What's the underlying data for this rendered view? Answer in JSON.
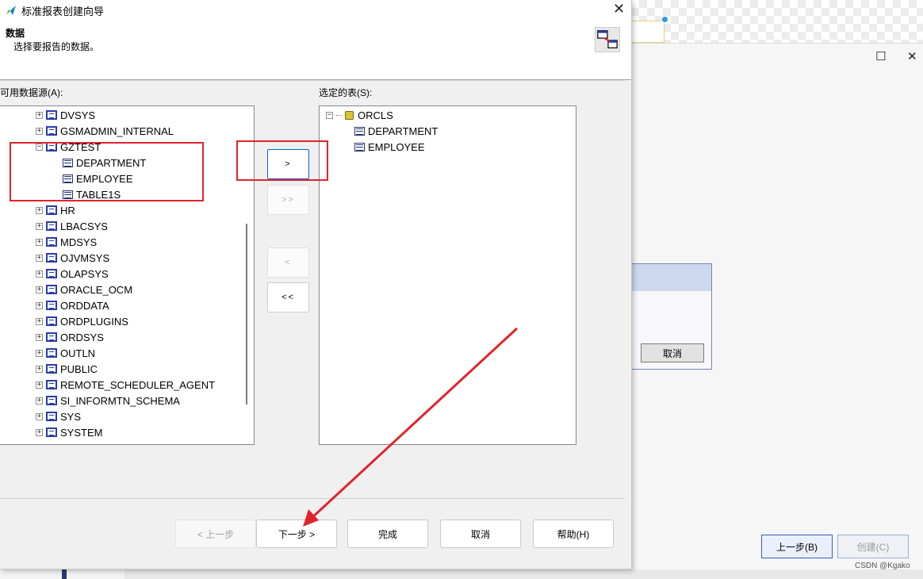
{
  "dialog": {
    "title": "标准报表创建向导",
    "close_symbol": "✕",
    "header_title": "数据",
    "header_subtitle": "选择要报告的数据。"
  },
  "available": {
    "label": "可用数据源(A):",
    "items": [
      {
        "name": "DVSYS",
        "expander": "+",
        "type": "schema"
      },
      {
        "name": "GSMADMIN_INTERNAL",
        "expander": "+",
        "type": "schema"
      },
      {
        "name": "GZTEST",
        "expander": "−",
        "type": "schema"
      },
      {
        "name": "DEPARTMENT",
        "expander": "",
        "type": "table"
      },
      {
        "name": "EMPLOYEE",
        "expander": "",
        "type": "table"
      },
      {
        "name": "TABLE1S",
        "expander": "",
        "type": "table"
      },
      {
        "name": "HR",
        "expander": "+",
        "type": "schema"
      },
      {
        "name": "LBACSYS",
        "expander": "+",
        "type": "schema"
      },
      {
        "name": "MDSYS",
        "expander": "+",
        "type": "schema"
      },
      {
        "name": "OJVMSYS",
        "expander": "+",
        "type": "schema"
      },
      {
        "name": "OLAPSYS",
        "expander": "+",
        "type": "schema"
      },
      {
        "name": "ORACLE_OCM",
        "expander": "+",
        "type": "schema"
      },
      {
        "name": "ORDDATA",
        "expander": "+",
        "type": "schema"
      },
      {
        "name": "ORDPLUGINS",
        "expander": "+",
        "type": "schema"
      },
      {
        "name": "ORDSYS",
        "expander": "+",
        "type": "schema"
      },
      {
        "name": "OUTLN",
        "expander": "+",
        "type": "schema"
      },
      {
        "name": "PUBLIC",
        "expander": "+",
        "type": "schema"
      },
      {
        "name": "REMOTE_SCHEDULER_AGENT",
        "expander": "+",
        "type": "schema"
      },
      {
        "name": "SI_INFORMTN_SCHEMA",
        "expander": "+",
        "type": "schema"
      },
      {
        "name": "SYS",
        "expander": "+",
        "type": "schema"
      },
      {
        "name": "SYSTEM",
        "expander": "+",
        "type": "schema"
      }
    ]
  },
  "selected": {
    "label": "选定的表(S):",
    "root": {
      "name": "ORCLS",
      "expander": "−"
    },
    "items": [
      "DEPARTMENT",
      "EMPLOYEE"
    ]
  },
  "transfer": {
    "add_one": ">",
    "add_all": ">>",
    "remove_one": "<",
    "remove_all": "<<"
  },
  "footer": {
    "back": "< 上一步",
    "next": "下一步 >",
    "finish": "完成",
    "cancel": "取消",
    "help": "帮助(H)"
  },
  "background_window": {
    "maximize_symbol": "☐",
    "close_symbol": "✕",
    "panel_cancel": "取消",
    "back": "上一步(B)",
    "create": "创建(C)"
  },
  "watermark": "CSDN @Kgako",
  "colors": {
    "annotation_red": "#e0242b",
    "schema_icon_blue": "#2a3ca8",
    "focus_blue": "#0b63c4"
  }
}
